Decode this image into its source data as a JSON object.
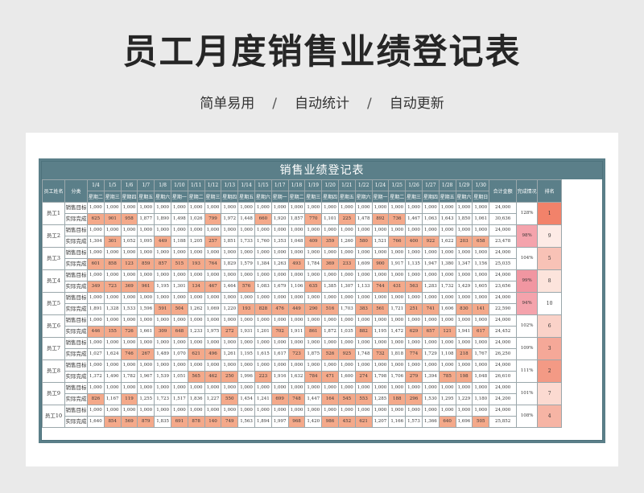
{
  "header": {
    "title": "员工月度销售业绩登记表",
    "tags": [
      "简单易用",
      "自动统计",
      "自动更新"
    ],
    "separator": "/"
  },
  "table": {
    "title": "销售业绩登记表",
    "col_name": "员工姓名",
    "col_type": "分类",
    "col_total": "合计金额",
    "col_ratio": "完成情况",
    "col_rank": "排名",
    "dates": [
      "1/4",
      "1/5",
      "1/6",
      "1/7",
      "1/8",
      "1/10",
      "1/11",
      "1/12",
      "1/13",
      "1/14",
      "1/15",
      "1/17",
      "1/18",
      "1/19",
      "1/20",
      "1/21",
      "1/22",
      "1/24",
      "1/25",
      "1/26",
      "1/27",
      "1/28",
      "1/29",
      "1/30"
    ],
    "weekdays": [
      "星期二",
      "星期三",
      "星期四",
      "星期五",
      "星期六",
      "星期一",
      "星期二",
      "星期三",
      "星期四",
      "星期五",
      "星期六",
      "星期一",
      "星期二",
      "星期三",
      "星期四",
      "星期五",
      "星期六",
      "星期一",
      "星期二",
      "星期三",
      "星期四",
      "星期五",
      "星期六",
      "星期日"
    ],
    "target_label": "销售目标",
    "actual_label": "实际完成",
    "target_values": [
      "1,000",
      "1,000",
      "1,000",
      "1,000",
      "1,000",
      "1,000",
      "1,000",
      "1,000",
      "1,000",
      "1,000",
      "1,000",
      "1,000",
      "1,000",
      "1,000",
      "1,000",
      "1,000",
      "1,000",
      "1,000",
      "1,000",
      "1,000",
      "1,000",
      "1,000",
      "1,000",
      "1,000"
    ],
    "target_total": "24,000",
    "employees": [
      {
        "name": "员工1",
        "actual": [
          "625",
          "901",
          "958",
          "1,877",
          "1,890",
          "1,498",
          "1,026",
          "799",
          "1,972",
          "1,448",
          "660",
          "1,920",
          "1,857",
          "770",
          "1,101",
          "225",
          "1,478",
          "892",
          "736",
          "1,467",
          "1,063",
          "1,643",
          "1,850",
          "1,061"
        ],
        "hl": [
          0,
          1,
          2,
          7,
          10,
          13,
          15,
          17,
          18
        ],
        "total": "30,636",
        "ratio": "128%",
        "ratio_color": "#ffffff",
        "rank": "1",
        "rank_color": "#f2826a"
      },
      {
        "name": "员工2",
        "actual": [
          "1,304",
          "301",
          "1,052",
          "1,095",
          "449",
          "1,188",
          "1,205",
          "257",
          "1,851",
          "1,733",
          "1,760",
          "1,353",
          "1,048",
          "409",
          "359",
          "1,260",
          "580",
          "1,521",
          "766",
          "400",
          "922",
          "1,622",
          "203",
          "658"
        ],
        "hl": [
          1,
          4,
          7,
          13,
          14,
          16,
          18,
          19,
          20,
          22,
          23
        ],
        "total": "23,478",
        "ratio": "98%",
        "ratio_color": "#f4a3ac",
        "rank": "9",
        "rank_color": "#fdebe6"
      },
      {
        "name": "员工3",
        "actual": [
          "601",
          "858",
          "123",
          "859",
          "857",
          "515",
          "193",
          "764",
          "1,829",
          "1,579",
          "1,384",
          "1,263",
          "493",
          "1,784",
          "369",
          "233",
          "1,609",
          "900",
          "1,917",
          "1,135",
          "1,947",
          "1,380",
          "1,347",
          "1,156"
        ],
        "hl": [
          0,
          1,
          2,
          3,
          4,
          5,
          6,
          7,
          12,
          14,
          15,
          17
        ],
        "total": "25,035",
        "ratio": "104%",
        "ratio_color": "#ffffff",
        "rank": "5",
        "rank_color": "#f8c2b6"
      },
      {
        "name": "员工4",
        "actual": [
          "349",
          "723",
          "369",
          "961",
          "1,195",
          "1,301",
          "134",
          "467",
          "1,464",
          "576",
          "1,083",
          "1,679",
          "1,106",
          "635",
          "1,385",
          "1,307",
          "1,133",
          "744",
          "431",
          "563",
          "1,283",
          "1,732",
          "1,429",
          "1,605"
        ],
        "hl": [
          0,
          1,
          2,
          3,
          6,
          7,
          9,
          13,
          17,
          18,
          19
        ],
        "total": "23,656",
        "ratio": "99%",
        "ratio_color": "#f196a1",
        "rank": "8",
        "rank_color": "#fce4dc"
      },
      {
        "name": "员工5",
        "actual": [
          "1,891",
          "1,328",
          "1,533",
          "1,596",
          "591",
          "504",
          "1,262",
          "1,069",
          "1,220",
          "193",
          "828",
          "476",
          "449",
          "290",
          "516",
          "1,703",
          "383",
          "561",
          "1,721",
          "251",
          "741",
          "1,606",
          "830",
          "141"
        ],
        "hl": [
          4,
          5,
          9,
          10,
          11,
          12,
          13,
          14,
          16,
          17,
          19,
          20,
          22,
          23
        ],
        "total": "22,590",
        "ratio": "94%",
        "ratio_color": "#f4a3ac",
        "rank": "10",
        "rank_color": "#ffffff"
      },
      {
        "name": "员工6",
        "actual": [
          "446",
          "155",
          "726",
          "1,661",
          "309",
          "648",
          "1,233",
          "1,975",
          "272",
          "1,931",
          "1,201",
          "702",
          "1,911",
          "861",
          "1,872",
          "1,035",
          "882",
          "1,195",
          "1,472",
          "629",
          "657",
          "121",
          "1,941",
          "617"
        ],
        "hl": [
          0,
          1,
          2,
          4,
          5,
          8,
          11,
          13,
          16,
          19,
          20,
          21,
          23
        ],
        "total": "24,452",
        "ratio": "102%",
        "ratio_color": "#ffffff",
        "rank": "6",
        "rank_color": "#fad2c8"
      },
      {
        "name": "员工7",
        "actual": [
          "1,027",
          "1,624",
          "746",
          "267",
          "1,489",
          "1,070",
          "621",
          "496",
          "1,261",
          "1,195",
          "1,615",
          "1,617",
          "723",
          "1,875",
          "526",
          "925",
          "1,748",
          "732",
          "1,818",
          "774",
          "1,729",
          "1,108",
          "218",
          "1,767"
        ],
        "hl": [
          2,
          3,
          6,
          7,
          12,
          14,
          15,
          17,
          19,
          22
        ],
        "total": "26,250",
        "ratio": "109%",
        "ratio_color": "#ffffff",
        "rank": "3",
        "rank_color": "#f5a898"
      },
      {
        "name": "员工8",
        "actual": [
          "1,372",
          "1,490",
          "1,782",
          "1,967",
          "1,539",
          "1,051",
          "565",
          "462",
          "250",
          "1,996",
          "223",
          "1,916",
          "1,632",
          "784",
          "471",
          "1,600",
          "274",
          "1,798",
          "1,706",
          "279",
          "1,394",
          "785",
          "198",
          "1,048"
        ],
        "hl": [
          6,
          7,
          8,
          10,
          13,
          14,
          16,
          19,
          21,
          22
        ],
        "total": "26,610",
        "ratio": "111%",
        "ratio_color": "#ffffff",
        "rank": "2",
        "rank_color": "#f39a85"
      },
      {
        "name": "员工9",
        "actual": [
          "826",
          "1,167",
          "119",
          "1,255",
          "1,723",
          "1,517",
          "1,836",
          "1,227",
          "550",
          "1,454",
          "1,241",
          "699",
          "748",
          "1,447",
          "164",
          "545",
          "553",
          "1,285",
          "188",
          "296",
          "1,530",
          "1,295",
          "1,229",
          "1,180"
        ],
        "hl": [
          0,
          2,
          8,
          11,
          12,
          14,
          15,
          16,
          18,
          19
        ],
        "total": "24,200",
        "ratio": "101%",
        "ratio_color": "#ffffff",
        "rank": "7",
        "rank_color": "#fbdad1"
      },
      {
        "name": "员工10",
        "actual": [
          "1,640",
          "854",
          "569",
          "879",
          "1,835",
          "691",
          "878",
          "140",
          "749",
          "1,563",
          "1,894",
          "1,997",
          "968",
          "1,420",
          "986",
          "452",
          "621",
          "1,207",
          "1,166",
          "1,573",
          "1,366",
          "640",
          "1,696",
          "505"
        ],
        "hl": [
          1,
          2,
          3,
          5,
          6,
          7,
          8,
          12,
          14,
          15,
          16,
          21,
          23
        ],
        "total": "25,852",
        "ratio": "108%",
        "ratio_color": "#ffffff",
        "rank": "4",
        "rank_color": "#f6b4a4"
      }
    ]
  }
}
